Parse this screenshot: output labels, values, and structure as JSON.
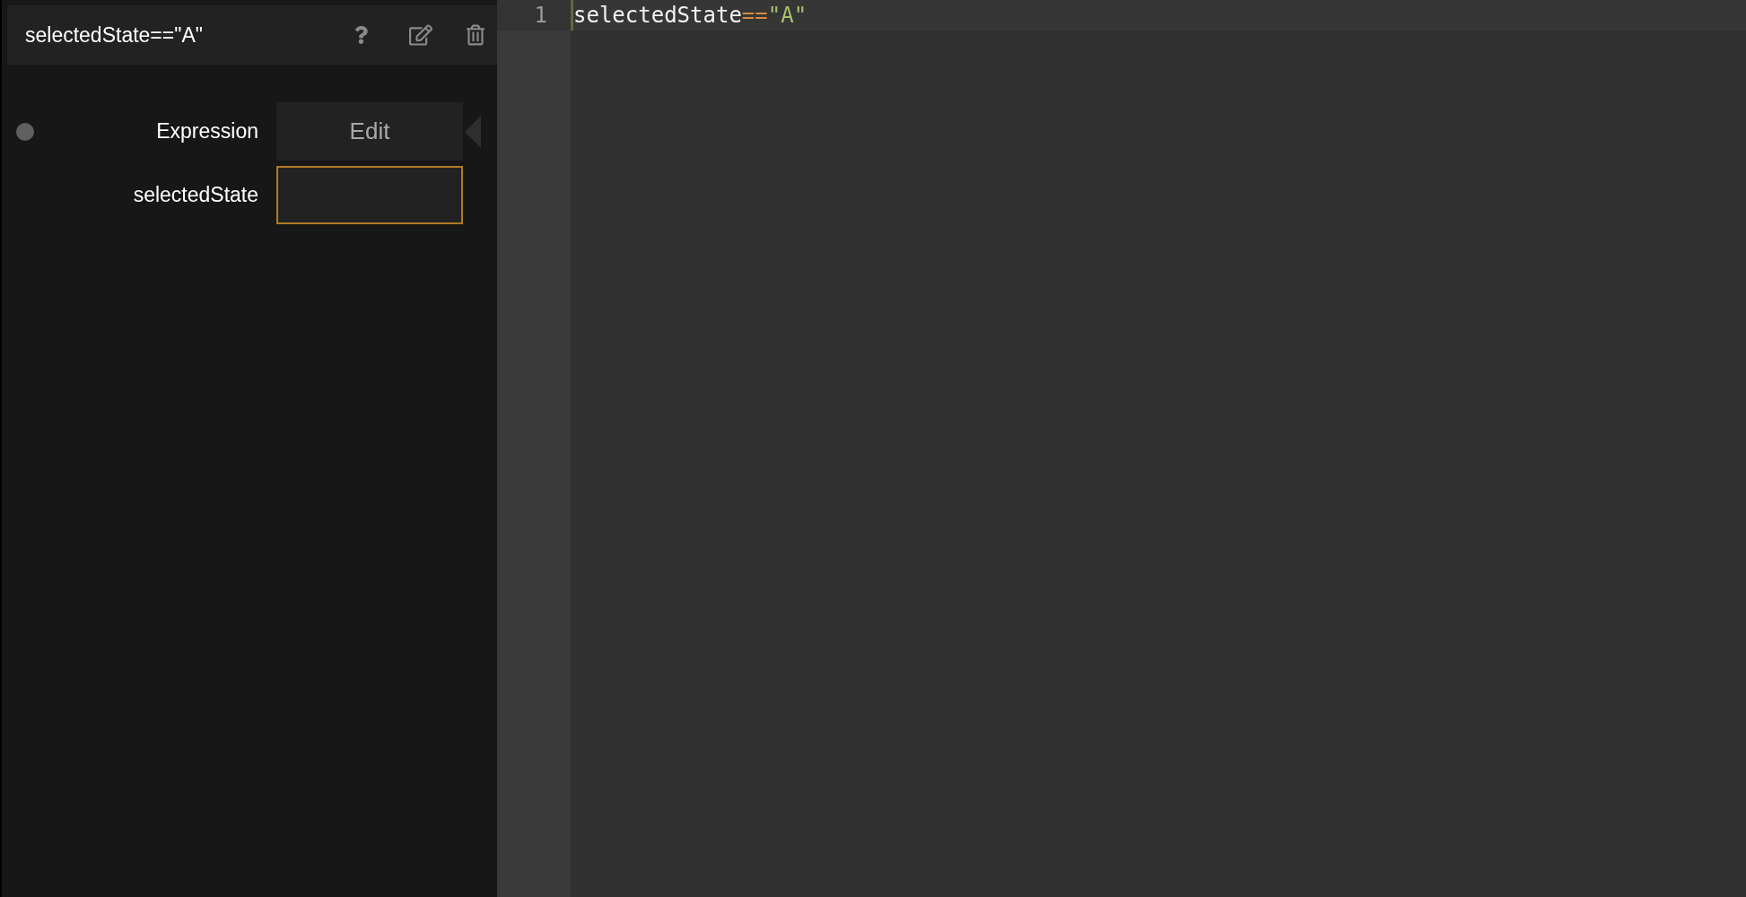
{
  "node": {
    "title": "selectedState==\"A\""
  },
  "rows": [
    {
      "kind": "button",
      "label": "Expression",
      "has_port": true,
      "value": "Edit",
      "focused": false
    },
    {
      "kind": "input",
      "label": "selectedState",
      "has_port": false,
      "value": "",
      "focused": true
    }
  ],
  "editor": {
    "lines": [
      {
        "number": "1",
        "tokens": [
          {
            "kind": "identifier",
            "text": "selectedState"
          },
          {
            "kind": "operator",
            "text": "=="
          },
          {
            "kind": "string",
            "text": "\"A\""
          }
        ]
      }
    ]
  }
}
